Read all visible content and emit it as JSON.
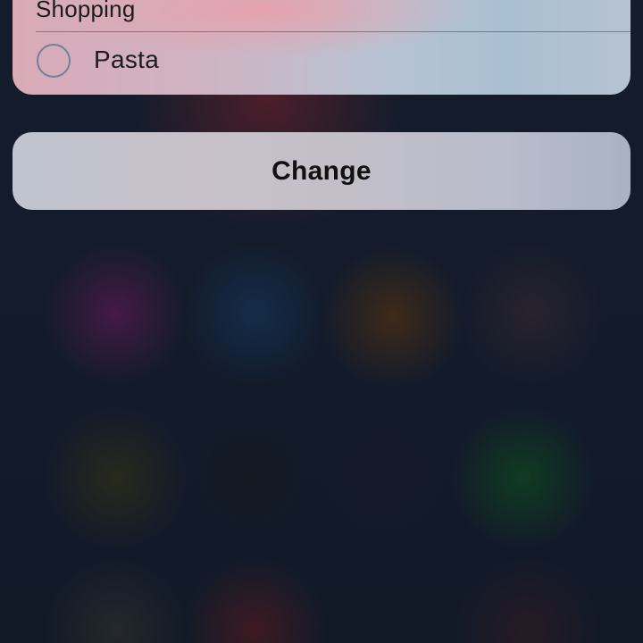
{
  "list_card": {
    "title": "Shopping",
    "items": [
      {
        "label": "Pasta",
        "checked": false
      }
    ]
  },
  "actions": {
    "change_label": "Change"
  },
  "colors": {
    "background": "#121b2b",
    "card_tint": "#d9aab8",
    "radio_border": "#6f829a",
    "text": "#1c1c1e"
  }
}
